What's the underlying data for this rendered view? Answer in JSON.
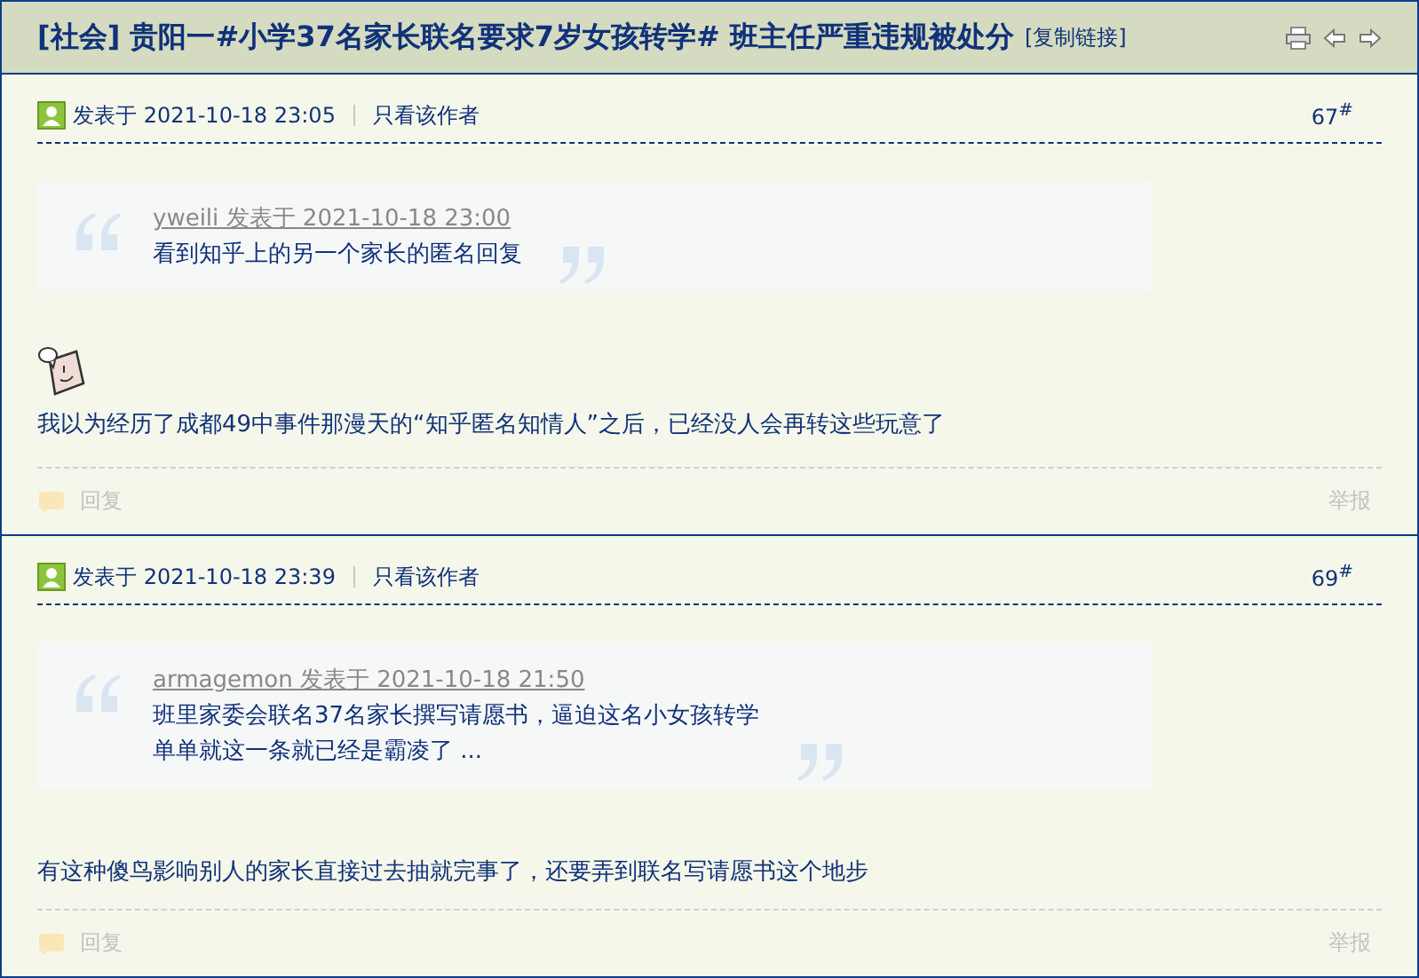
{
  "thread": {
    "category": "[社会]",
    "title": "贵阳一#小学37名家长联名要求7岁女孩转学# 班主任严重违规被处分",
    "copy_link": "[复制链接]"
  },
  "posts": [
    {
      "posted": "发表于 2021-10-18 23:05",
      "author_only": "只看该作者",
      "floor": "67$^{#}$",
      "quote": {
        "byline": "yweili 发表于 2021-10-18 23:00",
        "lines": [
          "看到知乎上的另一个家长的匿名回复"
        ]
      },
      "sticker": true,
      "body": "我以为经历了成都49中事件那漫天的“知乎匿名知情人”之后，已经没人会再转这些玩意了",
      "reply": "回复",
      "report": "举报"
    },
    {
      "posted": "发表于 2021-10-18 23:39",
      "author_only": "只看该作者",
      "floor": "69$^{#}$",
      "quote": {
        "byline": "armagemon 发表于 2021-10-18 21:50",
        "lines": [
          "班里家委会联名37名家长撰写请愿书，逼迫这名小女孩转学",
          "单单就这一条就已经是霸凌了 ..."
        ]
      },
      "sticker": false,
      "body": "有这种傻鸟影响别人的家长直接过去抽就完事了，还要弄到联名写请愿书这个地步",
      "reply": "回复",
      "report": "举报"
    }
  ]
}
